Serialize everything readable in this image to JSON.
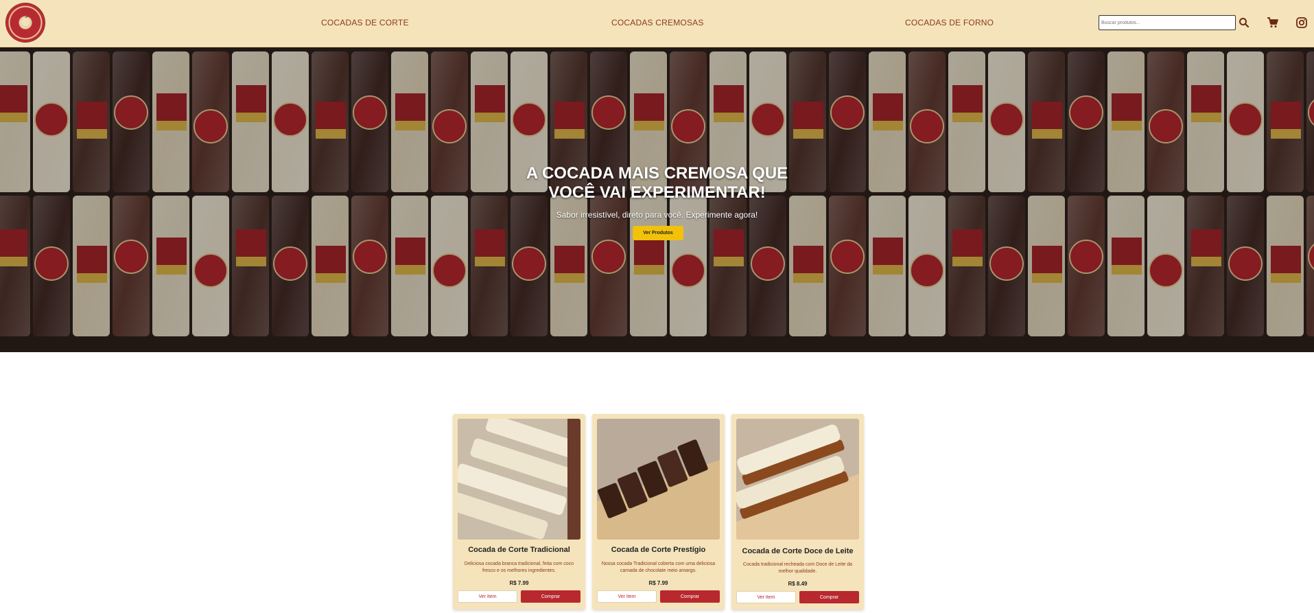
{
  "header": {
    "nav": [
      {
        "label": "COCADAS DE CORTE"
      },
      {
        "label": "COCADAS CREMOSAS"
      },
      {
        "label": "COCADAS DE FORNO"
      }
    ],
    "search_placeholder": "Buscar produtos...",
    "icons": [
      "logo",
      "search-icon",
      "cart-icon",
      "instagram-icon"
    ]
  },
  "hero": {
    "title_line1": "A COCADA MAIS CREMOSA QUE",
    "title_line2": "VOCÊ VAI EXPERIMENTAR!",
    "subtitle": "Sabor irresistível, direto para você. Experimente agora!",
    "button_label": "Ver Produtos"
  },
  "products": [
    {
      "name": "Cocada de Corte Tradicional",
      "description": "Deliciosa cocada branca tradicional, feita com coco fresco e os melhores ingredientes.",
      "price": "R$ 7.99",
      "view_label": "Ver Item",
      "buy_label": "Comprar"
    },
    {
      "name": "Cocada de Corte Prestígio",
      "description": "Nossa cocada Tradicional coberta com uma deliciosa camada de chocolate meio amargo.",
      "price": "R$ 7.99",
      "view_label": "Ver Item",
      "buy_label": "Comprar"
    },
    {
      "name": "Cocada de Corte Doce de Leite",
      "description": "Cocada tradicional recheada com Doce de Leite da melhor qualidade.",
      "price": "R$ 8.49",
      "view_label": "Ver Item",
      "buy_label": "Comprar"
    }
  ],
  "colors": {
    "header_bg": "#f5e3bb",
    "nav_text": "#8b3a1a",
    "brand_red": "#b8282f",
    "hero_button": "#f2c20a"
  }
}
